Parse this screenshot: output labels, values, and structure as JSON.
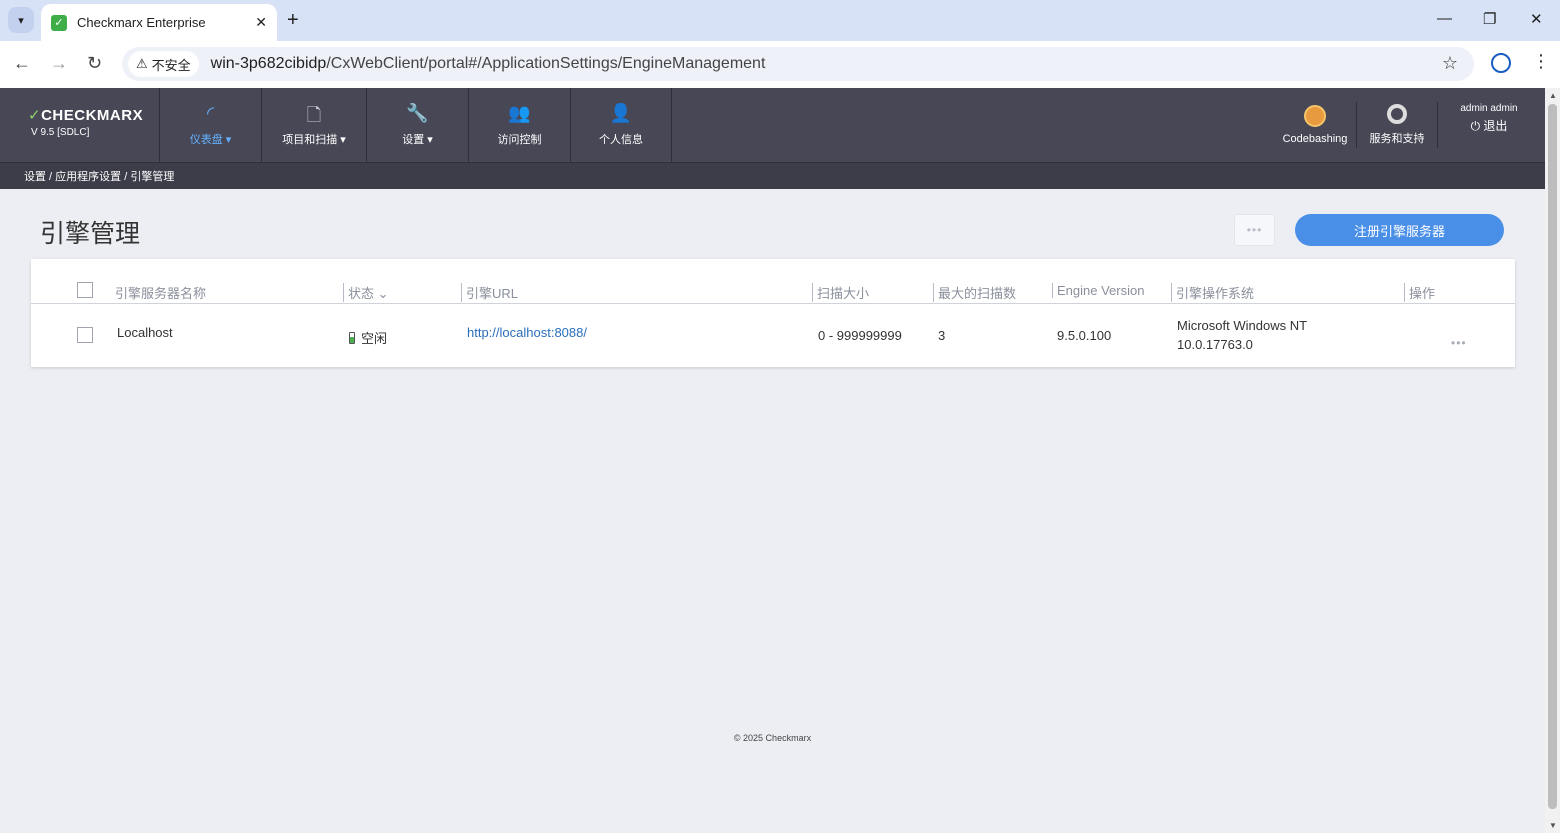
{
  "browser": {
    "tab_title": "Checkmarx Enterprise",
    "security_label": "不安全",
    "url_host": "win-3p682cibidp",
    "url_path": "/CxWebClient/portal#/ApplicationSettings/EngineManagement"
  },
  "app": {
    "brand": "CHECKMARX",
    "version": "V 9.5  [SDLC]",
    "menu": [
      {
        "label": "仪表盘",
        "icon": "gauge-icon",
        "dropdown": true,
        "active": true
      },
      {
        "label": "项目和扫描",
        "icon": "document-search-icon",
        "dropdown": true
      },
      {
        "label": "设置",
        "icon": "wrench-icon",
        "dropdown": true
      },
      {
        "label": "访问控制",
        "icon": "users-lock-icon",
        "dropdown": false
      },
      {
        "label": "个人信息",
        "icon": "user-settings-icon",
        "dropdown": false
      }
    ],
    "codebashing": "Codebashing",
    "support": "服务和支持",
    "user_name": "admin admin",
    "logout": "退出",
    "breadcrumb": "设置 / 应用程序设置 / 引擎管理"
  },
  "page": {
    "title": "引擎管理",
    "more_label": "•••",
    "register_button": "注册引擎服务器"
  },
  "table": {
    "columns": [
      "引擎服务器名称",
      "状态",
      "引擎URL",
      "扫描大小",
      "最大的扫描数",
      "Engine Version",
      "引擎操作系统",
      "操作"
    ],
    "rows": [
      {
        "name": "Localhost",
        "status": "空闲",
        "url": "http://localhost:8088/",
        "scan_size": "0 - 999999999",
        "max_scans": "3",
        "engine_version": "9.5.0.100",
        "os_line1": "Microsoft Windows NT",
        "os_line2": "10.0.17763.0",
        "actions": "•••"
      }
    ]
  },
  "footer": "© 2025 Checkmarx",
  "colors": {
    "header_bg": "#474756",
    "active_menu": "#64b2ff",
    "primary_button": "#4a8fe7",
    "link": "#2a6ebb",
    "status_idle": "#4caf50"
  }
}
